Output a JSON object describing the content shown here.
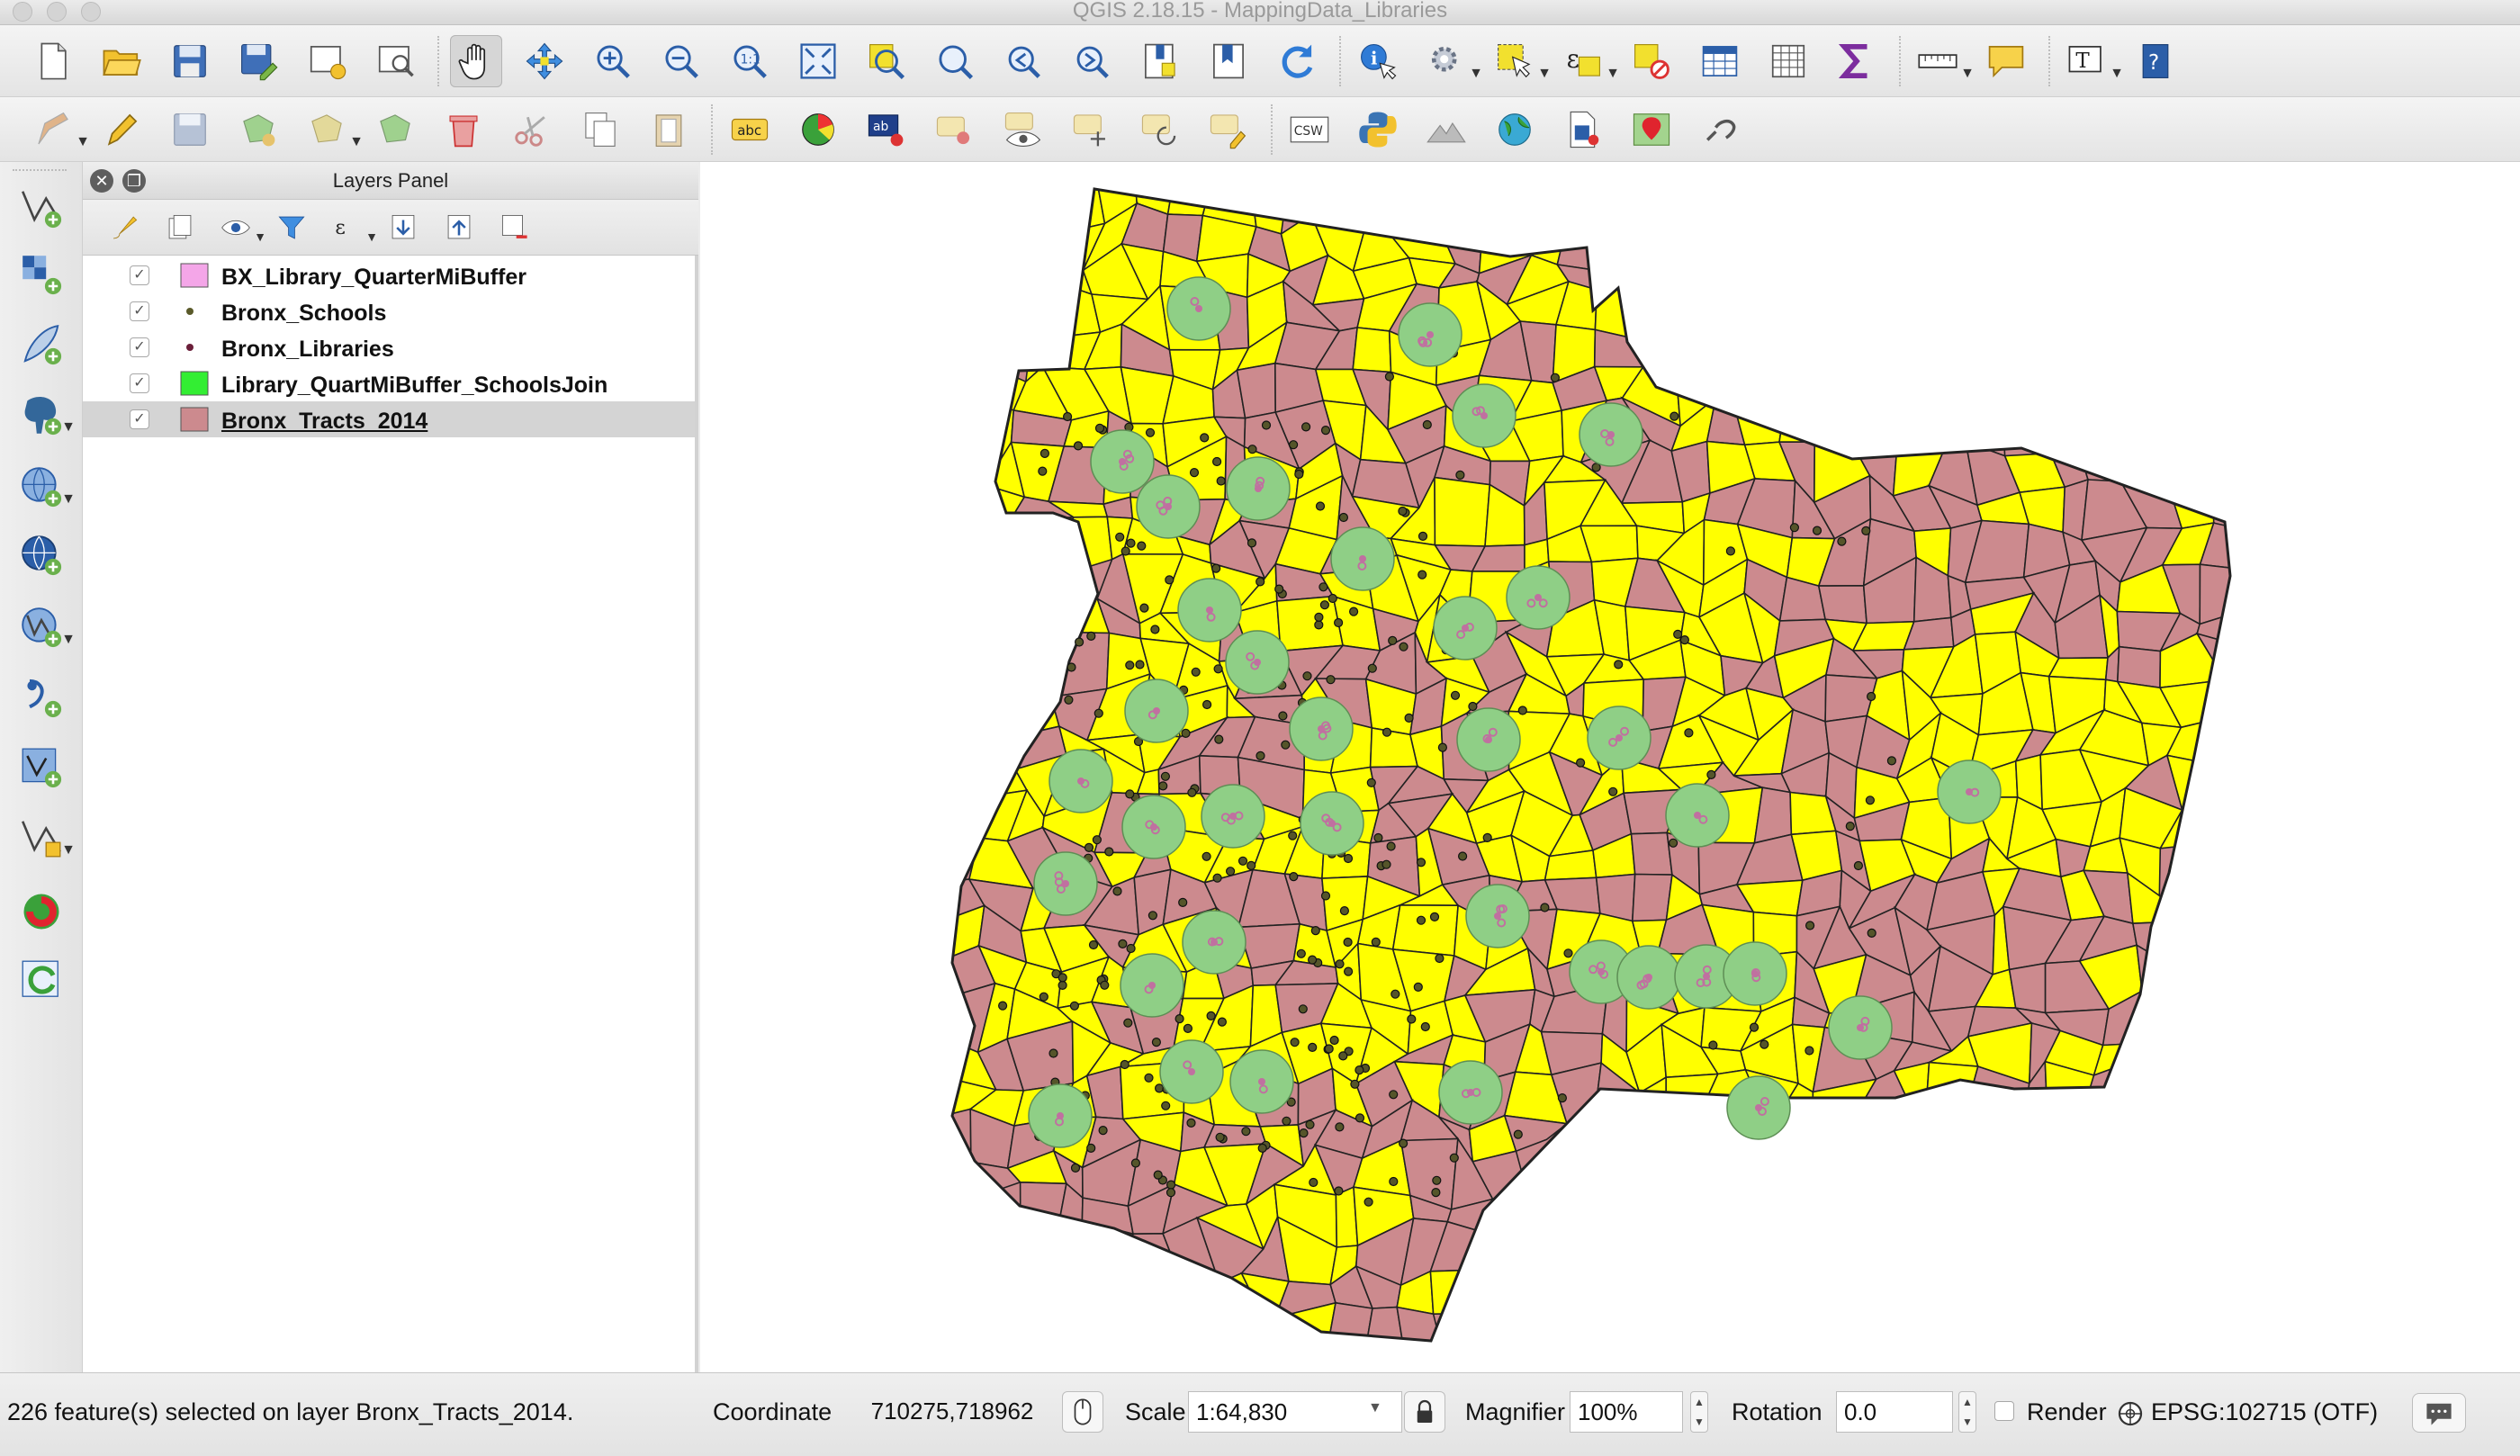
{
  "window": {
    "title": "QGIS 2.18.15 - MappingData_Libraries"
  },
  "toolbar1": {
    "buttons": [
      "new-project",
      "open-project",
      "save-project",
      "save-as",
      "new-print-composer",
      "composer-manager",
      "pan-map",
      "pan-to-selection",
      "zoom-in",
      "zoom-out",
      "zoom-native",
      "zoom-full",
      "zoom-to-selection",
      "zoom-to-layer",
      "zoom-last",
      "zoom-next",
      "new-map-view",
      "new-bookmark",
      "refresh",
      "identify-features",
      "run-feature-action",
      "select-features",
      "select-by-expression",
      "deselect-all",
      "open-attribute-table",
      "open-field-calculator",
      "show-statistical-summary",
      "measure-line",
      "show-map-tips",
      "text-annotation",
      "help"
    ]
  },
  "toolbar2": {
    "csw_label": "CSW",
    "label_abc": "abc"
  },
  "layers_panel": {
    "title": "Layers Panel",
    "layers": [
      {
        "name": "BX_Library_QuarterMiBuffer",
        "checked": "✓",
        "symbol": "fill",
        "color": "#f4a6e8",
        "selected": false
      },
      {
        "name": "Bronx_Schools",
        "checked": "✓",
        "symbol": "point",
        "color": "#5a5a2a",
        "selected": false
      },
      {
        "name": "Bronx_Libraries",
        "checked": "✓",
        "symbol": "point",
        "color": "#6b1f3a",
        "selected": false
      },
      {
        "name": "Library_QuartMiBuffer_SchoolsJoin",
        "checked": "✓",
        "symbol": "fill",
        "color": "#33ee33",
        "selected": false
      },
      {
        "name": "Bronx_Tracts_2014",
        "checked": "✓",
        "symbol": "fill",
        "color": "#cc8a8e",
        "selected": true
      }
    ]
  },
  "map": {
    "colors": {
      "selected_tract": "#ffff00",
      "unselected_tract": "#cc8a8e",
      "buffer": "#8fcf86",
      "library": "#c070a0",
      "school": "#55552a",
      "outline": "#222222"
    }
  },
  "statusbar": {
    "message": "226 feature(s) selected on layer Bronx_Tracts_2014.",
    "coordinate_label": "Coordinate",
    "coordinate_value": "710275,718962",
    "scale_label": "Scale",
    "scale_value": "1:64,830",
    "magnifier_label": "Magnifier",
    "magnifier_value": "100%",
    "rotation_label": "Rotation",
    "rotation_value": "0.0",
    "render_label": "Render",
    "crs_label": "EPSG:102715 (OTF)"
  }
}
